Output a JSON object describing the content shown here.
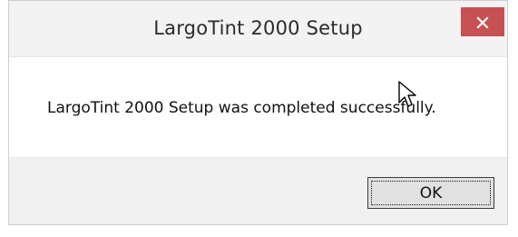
{
  "dialog": {
    "title": "LargoTint 2000 Setup",
    "message": "LargoTint 2000 Setup was completed successfully.",
    "ok_label": "OK",
    "close_icon": "close-icon",
    "cursor_icon": "arrow-cursor-icon"
  },
  "colors": {
    "close_button_bg": "#c75050",
    "dialog_bg": "#f0f0f0",
    "content_bg": "#ffffff"
  }
}
